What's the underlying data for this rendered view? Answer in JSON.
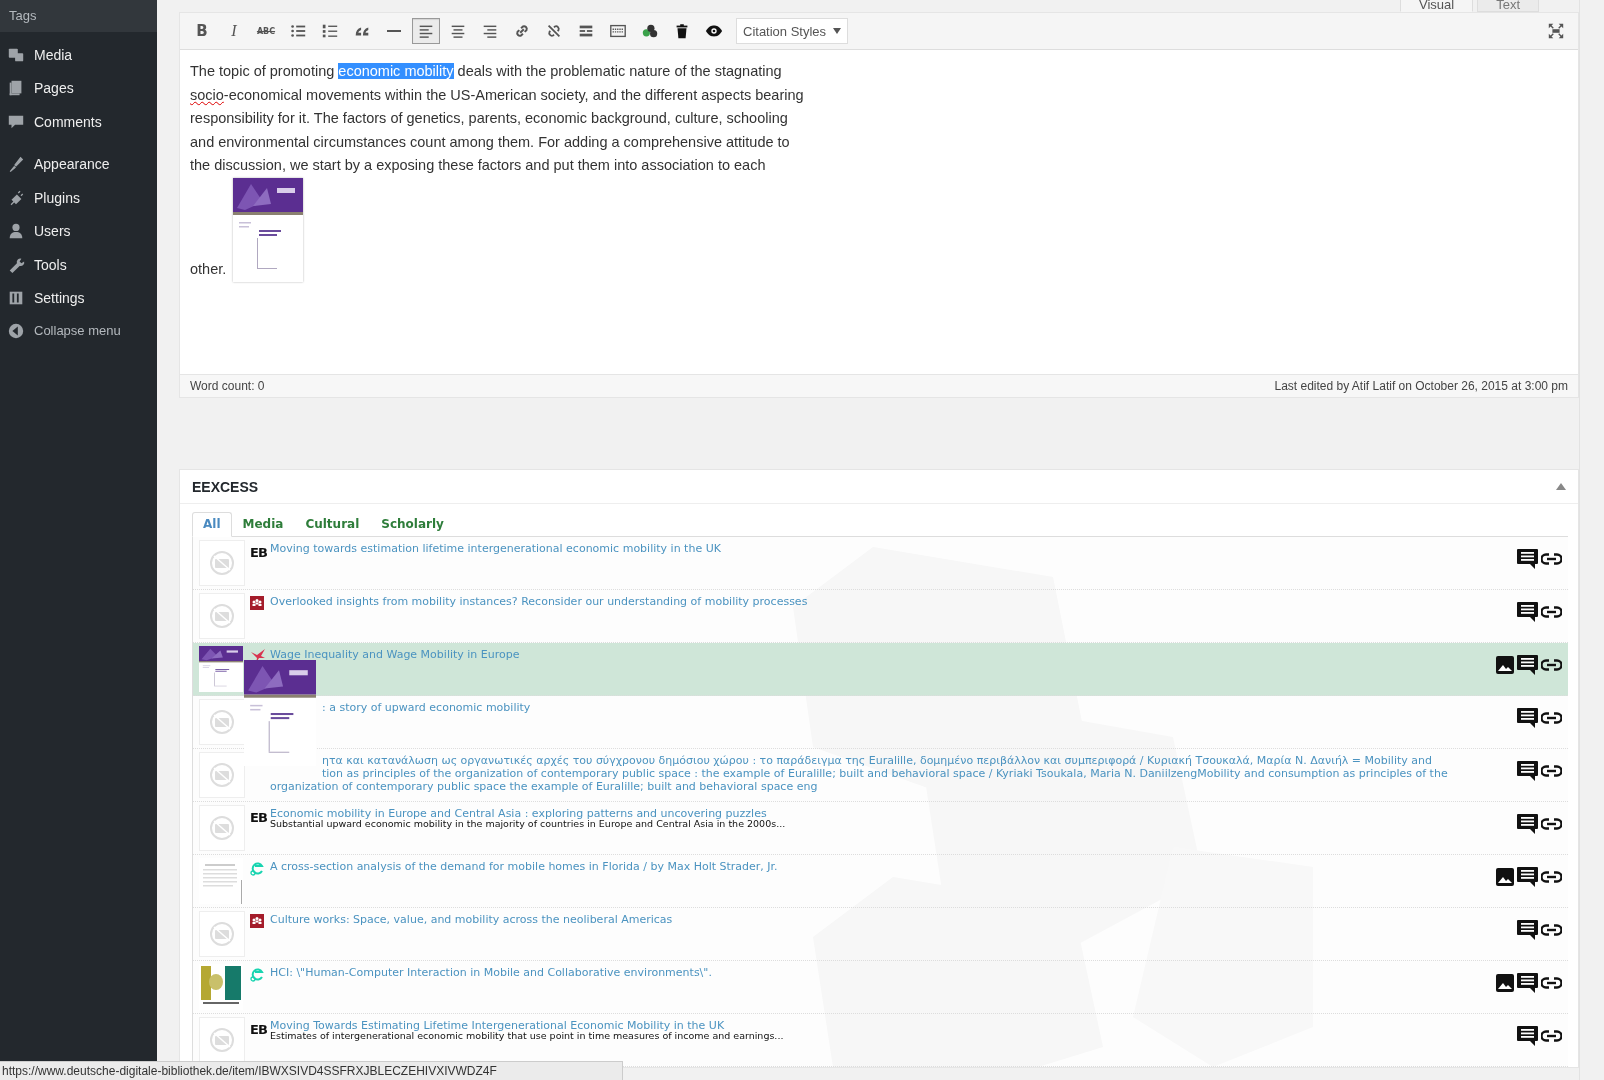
{
  "sidebar": {
    "submenu": [
      "Tags"
    ],
    "menu_groups": [
      [
        {
          "label": "Media",
          "kind": "media"
        },
        {
          "label": "Pages",
          "kind": "pages"
        },
        {
          "label": "Comments",
          "kind": "comments"
        }
      ],
      [
        {
          "label": "Appearance",
          "kind": "appearance"
        },
        {
          "label": "Plugins",
          "kind": "plugins"
        },
        {
          "label": "Users",
          "kind": "users"
        },
        {
          "label": "Tools",
          "kind": "tools"
        },
        {
          "label": "Settings",
          "kind": "settings"
        }
      ]
    ],
    "collapse": "Collapse menu"
  },
  "editor": {
    "mode_tabs": [
      {
        "label": "Visual",
        "selected": true
      },
      {
        "label": "Text",
        "selected": false
      }
    ],
    "toolbar": [
      {
        "kind": "bold",
        "label": "B",
        "pressed": false
      },
      {
        "kind": "italic",
        "label": "I",
        "pressed": false
      },
      {
        "kind": "strikethrough",
        "label": "ABC",
        "pressed": false
      },
      {
        "kind": "bullet-list",
        "pressed": false
      },
      {
        "kind": "numbered-list",
        "pressed": false
      },
      {
        "kind": "blockquote",
        "pressed": false
      },
      {
        "kind": "horizontal-rule",
        "pressed": false
      },
      {
        "kind": "align-left",
        "pressed": true
      },
      {
        "kind": "align-center",
        "pressed": false
      },
      {
        "kind": "align-right",
        "pressed": false
      },
      {
        "kind": "link",
        "pressed": false
      },
      {
        "kind": "unlink",
        "pressed": false
      },
      {
        "kind": "read-more",
        "pressed": false
      },
      {
        "kind": "toolbar-toggle",
        "pressed": false
      },
      {
        "kind": "plugin",
        "pressed": false
      },
      {
        "kind": "trash",
        "pressed": false
      },
      {
        "kind": "preview",
        "pressed": false
      }
    ],
    "citation_styles": "Citation Styles",
    "paragraph": [
      {
        "text": "The topic of promoting ",
        "selected": false,
        "misspelled": false
      },
      {
        "text": "economic mobility",
        "selected": true,
        "misspelled": false
      },
      {
        "text": " deals with the problematic nature of the stagnating ",
        "selected": false,
        "misspelled": false
      },
      {
        "text": "socio",
        "selected": false,
        "misspelled": true
      },
      {
        "text": "-economical movements within the US-American society, and the different aspects bearing responsibility for it. The factors of genetics, parents, economic background, culture, schooling and environmental circumstances count among them. For adding a comprehensive attitude to the discussion, we start by a exposing these factors and put them into association to each other.",
        "selected": false,
        "misspelled": false
      }
    ],
    "word_count": "Word count: 0",
    "last_edited": "Last edited by Atif Latif on October 26, 2015 at 3:00 pm"
  },
  "eexcess": {
    "title": "EEXCESS",
    "collapsed": false,
    "tabs": [
      {
        "label": "All",
        "selected": true
      },
      {
        "label": "Media",
        "selected": false
      },
      {
        "label": "Cultural",
        "selected": false
      },
      {
        "label": "Scholarly",
        "selected": false
      }
    ],
    "results": [
      {
        "thumbnail": {
          "kind": "none"
        },
        "source_logo": {
          "kind": "eb",
          "mark": "EB"
        },
        "title": "Moving towards estimation lifetime intergenerational economic mobility in the UK",
        "has_image": false,
        "selected": false
      },
      {
        "thumbnail": {
          "kind": "none"
        },
        "source_logo": {
          "kind": "people"
        },
        "title": "Overlooked insights from mobility instances? Reconsider our understanding of mobility processes",
        "has_image": false,
        "selected": false
      },
      {
        "thumbnail": {
          "kind": "cover"
        },
        "source_logo": {
          "kind": "bird"
        },
        "title": "Wage Inequality and Wage Mobility in Europe",
        "has_image": true,
        "selected": true
      },
      {
        "thumbnail": {
          "kind": "none"
        },
        "title": ": a story of upward economic mobility",
        "has_image": false,
        "selected": false
      },
      {
        "thumbnail": {
          "kind": "none"
        },
        "title_lines": [
          "ητα και κατανάλωση ως οργανωτικές αρχές του σύγχρονου δημόσιου χώρου : το παράδειγμα της Euralille, δομημένο περιβάλλον και συμπεριφορά / Κυριακή Τσουκαλά, Μαρία Ν. Δανιήλ = Mobility and",
          "tion as principles of the organization of contemporary public space : the example of Euralille; built and behavioral space / Kyriaki Tsoukala, Maria N. DaniilzengMobility and consumption as principles of the",
          "organization of contemporary public space the example of Euralille; built and behavioral space eng"
        ],
        "has_image": false,
        "selected": false
      },
      {
        "thumbnail": {
          "kind": "none"
        },
        "source_logo": {
          "kind": "eb",
          "mark": "EB"
        },
        "title": "Economic mobility in Europe and Central Asia : exploring patterns and uncovering puzzles",
        "description": "Substantial upward economic mobility in the majority of countries in Europe and Central Asia in the 2000s...",
        "has_image": false,
        "selected": false
      },
      {
        "thumbnail": {
          "kind": "scan"
        },
        "source_logo": {
          "kind": "e-logo"
        },
        "title": "A cross-section analysis of the demand for mobile homes in Florida / by Max Holt Strader, Jr.",
        "has_image": true,
        "selected": false
      },
      {
        "thumbnail": {
          "kind": "none"
        },
        "source_logo": {
          "kind": "people"
        },
        "title": "Culture works: Space, value, and mobility across the neoliberal Americas",
        "has_image": false,
        "selected": false
      },
      {
        "thumbnail": {
          "kind": "logo"
        },
        "source_logo": {
          "kind": "e-logo"
        },
        "title": "HCI: \\\"Human-Computer Interaction in Mobile and Collaborative environments\\\".",
        "has_image": true,
        "selected": false
      },
      {
        "thumbnail": {
          "kind": "none"
        },
        "source_logo": {
          "kind": "eb",
          "mark": "EB"
        },
        "title": "Moving Towards Estimating Lifetime Intergenerational Economic Mobility in the UK",
        "description": "Estimates of intergenerational economic mobility that use point in time measures of income and earnings...",
        "has_image": false,
        "selected": false
      }
    ]
  },
  "status_bar": {
    "url": "https://www.deutsche-digitale-bibliothek.de/item/IBWXSIVD4SSFRXJBLECZEHIVXIVWDZ4F"
  }
}
